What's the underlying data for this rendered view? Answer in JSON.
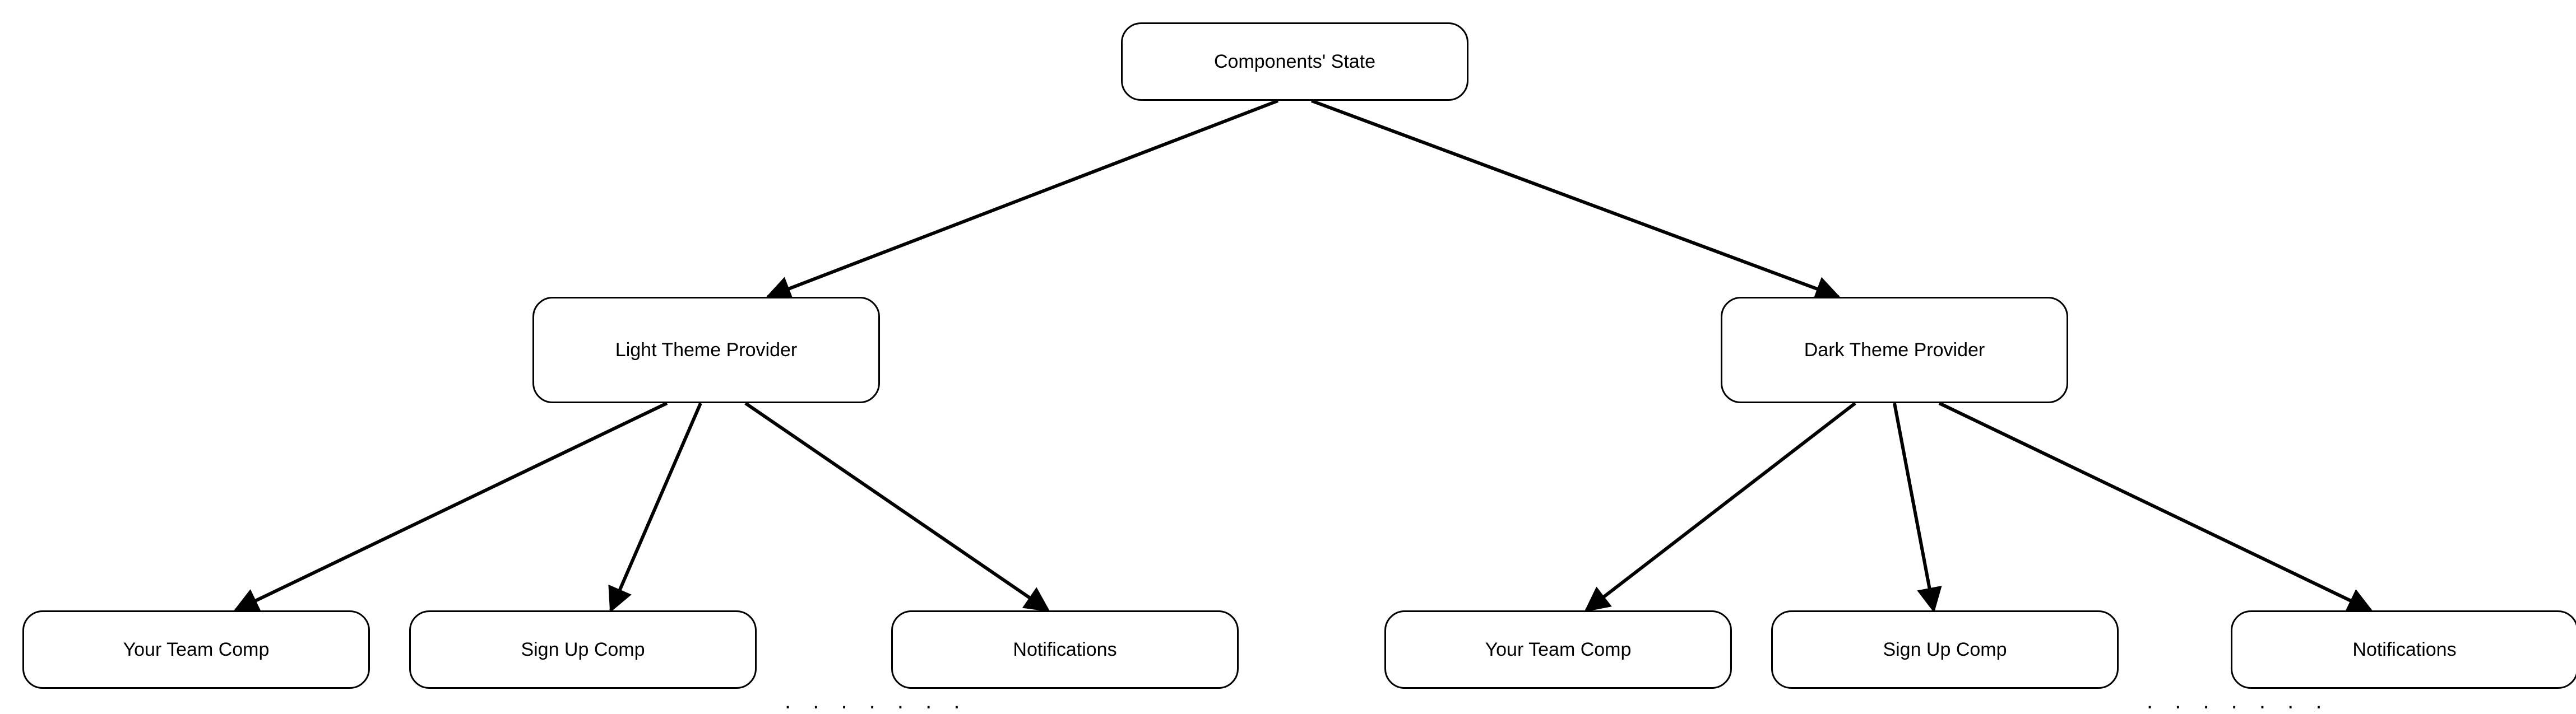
{
  "diagram": {
    "type": "tree",
    "direction": "top-down",
    "nodes": {
      "root": {
        "label": "Components' State"
      },
      "light": {
        "label": "Light Theme Provider"
      },
      "dark": {
        "label": "Dark Theme Provider"
      },
      "l_team": {
        "label": "Your Team Comp"
      },
      "l_signup": {
        "label": "Sign Up Comp"
      },
      "l_notif": {
        "label": "Notifications"
      },
      "r_team": {
        "label": "Your Team Comp"
      },
      "r_signup": {
        "label": "Sign Up Comp"
      },
      "r_notif": {
        "label": "Notifications"
      }
    },
    "edges": [
      [
        "root",
        "light"
      ],
      [
        "root",
        "dark"
      ],
      [
        "light",
        "l_team"
      ],
      [
        "light",
        "l_signup"
      ],
      [
        "light",
        "l_notif"
      ],
      [
        "dark",
        "r_team"
      ],
      [
        "dark",
        "r_signup"
      ],
      [
        "dark",
        "r_notif"
      ]
    ],
    "ellipsis": ". . . . . . ."
  }
}
